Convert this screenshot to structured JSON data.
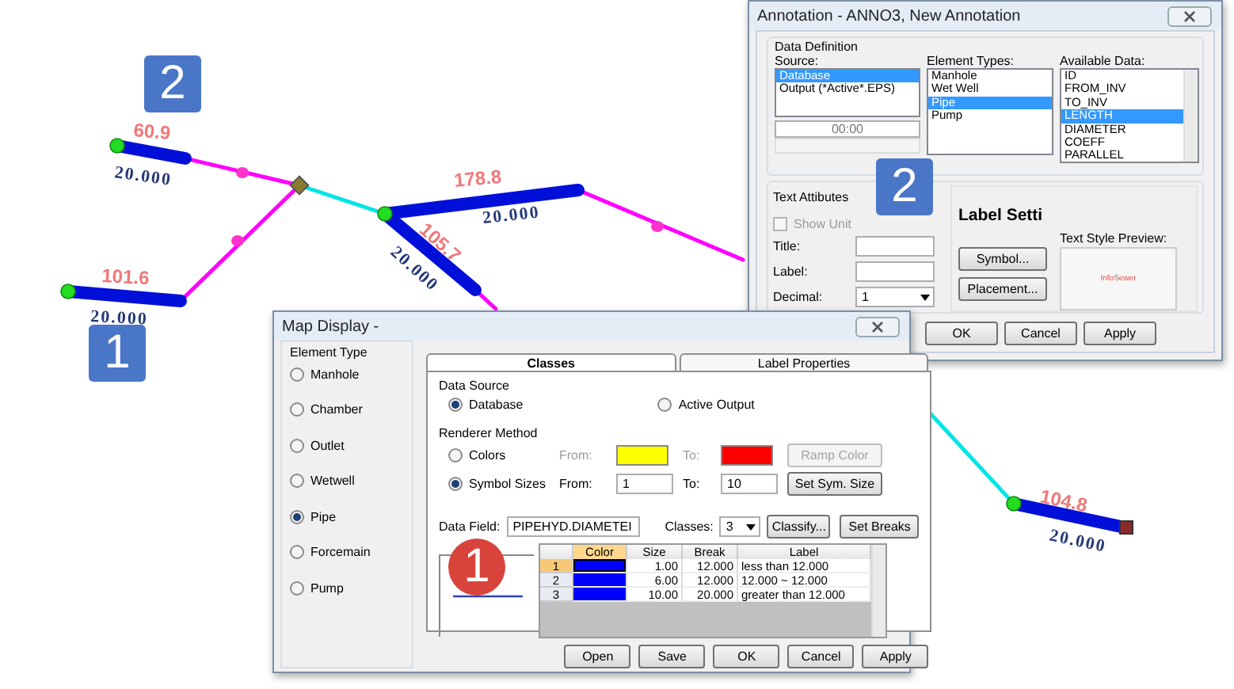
{
  "map": {
    "pipes": [
      {
        "length": "60.9",
        "diameter": "20.000"
      },
      {
        "length": "101.6",
        "diameter": "20.000"
      },
      {
        "length": "178.8",
        "diameter": "20.000"
      },
      {
        "length": "105.7",
        "diameter": "20.000"
      },
      {
        "length": "104.8",
        "diameter": "20.000"
      }
    ]
  },
  "callouts": [
    {
      "number": "2",
      "kind": "square"
    },
    {
      "number": "1",
      "kind": "square"
    },
    {
      "number": "2",
      "kind": "square"
    },
    {
      "number": "1",
      "kind": "circle"
    }
  ],
  "annotation_dialog": {
    "title": "Annotation - ANNO3, New Annotation",
    "data_definition": {
      "heading": "Data Definition",
      "source": {
        "label": "Source:",
        "items": [
          {
            "text": "Database",
            "selected": true
          },
          {
            "text": "Output (*Active*.EPS)",
            "selected": false
          }
        ],
        "time": "00:00"
      },
      "element_types": {
        "label": "Element Types:",
        "items": [
          {
            "text": "Manhole",
            "selected": false
          },
          {
            "text": "Wet Well",
            "selected": false
          },
          {
            "text": "Pipe",
            "selected": true
          },
          {
            "text": "Pump",
            "selected": false
          }
        ]
      },
      "available_data": {
        "label": "Available Data:",
        "items": [
          {
            "text": "ID",
            "selected": false
          },
          {
            "text": "FROM_INV",
            "selected": false
          },
          {
            "text": "TO_INV",
            "selected": false
          },
          {
            "text": "LENGTH",
            "selected": true
          },
          {
            "text": "DIAMETER",
            "selected": false
          },
          {
            "text": "COEFF",
            "selected": false
          },
          {
            "text": "PARALLEL",
            "selected": false
          }
        ]
      }
    },
    "text_attributes": {
      "heading": "Text Attibutes",
      "show_unit": {
        "label": "Show Unit",
        "checked": false,
        "disabled": true
      },
      "title_label": "Title:",
      "label_label": "Label:",
      "decimal_label": "Decimal:",
      "decimal_value": "1"
    },
    "label_settings": {
      "heading": "Label Setti",
      "buttons": [
        "Symbol...",
        "Placement..."
      ],
      "preview_label": "Text Style Preview:",
      "preview_text": "InfoSewer"
    },
    "buttons": [
      "OK",
      "Cancel",
      "Apply"
    ]
  },
  "map_display_dialog": {
    "title": "Map Display -",
    "element_type": {
      "heading": "Element Type",
      "options": [
        {
          "label": "Manhole",
          "selected": false
        },
        {
          "label": "Chamber",
          "selected": false
        },
        {
          "label": "Outlet",
          "selected": false
        },
        {
          "label": "Wetwell",
          "selected": false
        },
        {
          "label": "Pipe",
          "selected": true
        },
        {
          "label": "Forcemain",
          "selected": false
        },
        {
          "label": "Pump",
          "selected": false
        }
      ]
    },
    "tabs": [
      {
        "label": "Classes",
        "selected": true
      },
      {
        "label": "Label Properties",
        "selected": false
      }
    ],
    "data_source": {
      "heading": "Data Source",
      "options": [
        {
          "label": "Database",
          "selected": true
        },
        {
          "label": "Active Output",
          "selected": false
        }
      ]
    },
    "renderer": {
      "heading": "Renderer Method",
      "options": [
        {
          "label": "Colors",
          "selected": false
        },
        {
          "label": "Symbol Sizes",
          "selected": true
        }
      ],
      "color_ramp": [
        {
          "label": "From:",
          "color": "#ffff00"
        },
        {
          "label": "To:",
          "color": "#ff0000"
        }
      ],
      "ramp_button": {
        "label": "Ramp Color",
        "disabled": true
      },
      "size_from_label": "From:",
      "size_from": "1",
      "size_to_label": "To:",
      "size_to": "10",
      "size_button": {
        "label": "Set Sym. Size",
        "disabled": false
      }
    },
    "data_field": {
      "label": "Data Field:",
      "value": "PIPEHYD.DIAMETEI"
    },
    "classes": {
      "label": "Classes:",
      "value": "3"
    },
    "classify_button": "Classify...",
    "breaks_button": "Set Breaks",
    "table": {
      "columns": [
        "Color",
        "Size",
        "Break",
        "Label"
      ],
      "rows": [
        {
          "number": "1",
          "color": "#0000ff",
          "size": "1.00",
          "break": "12.000",
          "label": "less than 12.000",
          "selected": true
        },
        {
          "number": "2",
          "color": "#0000ff",
          "size": "6.00",
          "break": "12.000",
          "label": "12.000 ~ 12.000",
          "selected": false
        },
        {
          "number": "3",
          "color": "#0000ff",
          "size": "10.00",
          "break": "20.000",
          "label": "greater than 12.000",
          "selected": false
        }
      ]
    },
    "buttons": [
      "Open",
      "Save",
      "OK",
      "Cancel",
      "Apply"
    ]
  }
}
